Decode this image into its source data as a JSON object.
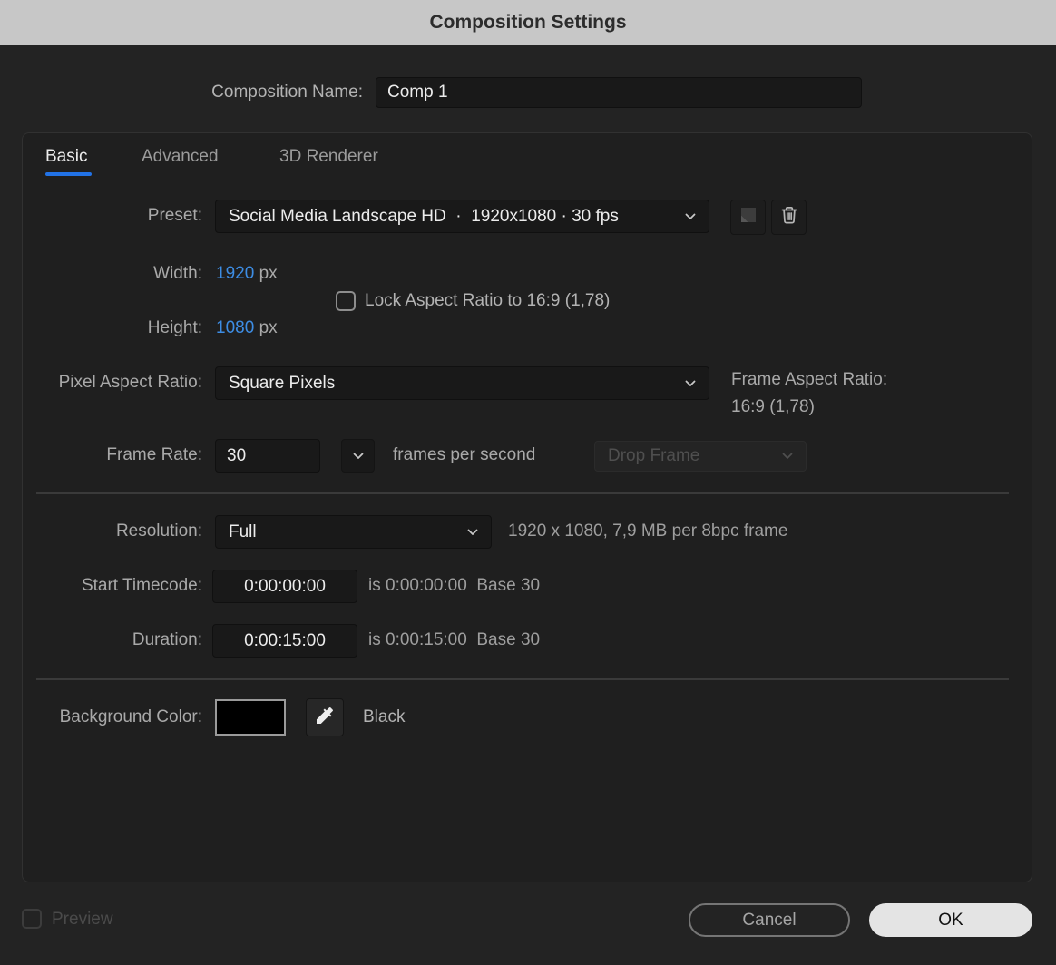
{
  "window": {
    "title": "Composition Settings"
  },
  "composition_name": {
    "label": "Composition Name:",
    "value": "Comp 1"
  },
  "tabs": [
    {
      "label": "Basic",
      "active": true
    },
    {
      "label": "Advanced",
      "active": false
    },
    {
      "label": "3D Renderer",
      "active": false
    }
  ],
  "basic": {
    "preset": {
      "label": "Preset:",
      "value": "Social Media Landscape HD  ·  1920x1080 · 30 fps"
    },
    "width": {
      "label": "Width:",
      "value": "1920",
      "unit": "px"
    },
    "height": {
      "label": "Height:",
      "value": "1080",
      "unit": "px"
    },
    "lock_aspect_ratio": {
      "label": "Lock Aspect Ratio to 16:9 (1,78)",
      "checked": false
    },
    "pixel_aspect_ratio": {
      "label": "Pixel Aspect Ratio:",
      "value": "Square Pixels"
    },
    "frame_aspect_ratio": {
      "label": "Frame Aspect Ratio:",
      "value": "16:9 (1,78)"
    },
    "frame_rate": {
      "label": "Frame Rate:",
      "value": "30",
      "suffix": "frames per second",
      "drop_frame_value": "Drop Frame",
      "drop_frame_enabled": false
    },
    "resolution": {
      "label": "Resolution:",
      "value": "Full",
      "info": "1920 x 1080, 7,9 MB per 8bpc frame"
    },
    "start_timecode": {
      "label": "Start Timecode:",
      "value": "0:00:00:00",
      "info": "is 0:00:00:00  Base 30"
    },
    "duration": {
      "label": "Duration:",
      "value": "0:00:15:00",
      "info": "is 0:00:15:00  Base 30"
    },
    "background_color": {
      "label": "Background Color:",
      "swatch_hex": "#000000",
      "name": "Black"
    }
  },
  "footer": {
    "preview": {
      "label": "Preview",
      "checked": false,
      "enabled": false
    },
    "cancel_label": "Cancel",
    "ok_label": "OK"
  },
  "icons": {
    "chevron_down": "⌄ chevron-down",
    "save_preset": "folded-corner square (save preset)",
    "delete_preset": "trash can",
    "eyedropper": "color eyedropper"
  },
  "colors": {
    "titlebar_bg": "#c7c7c7",
    "dialog_bg": "#232323",
    "panel_bg": "#1f1f1f",
    "accent_blue": "#2273e7",
    "value_blue": "#3d8de4",
    "background_color_swatch": "#000000"
  }
}
